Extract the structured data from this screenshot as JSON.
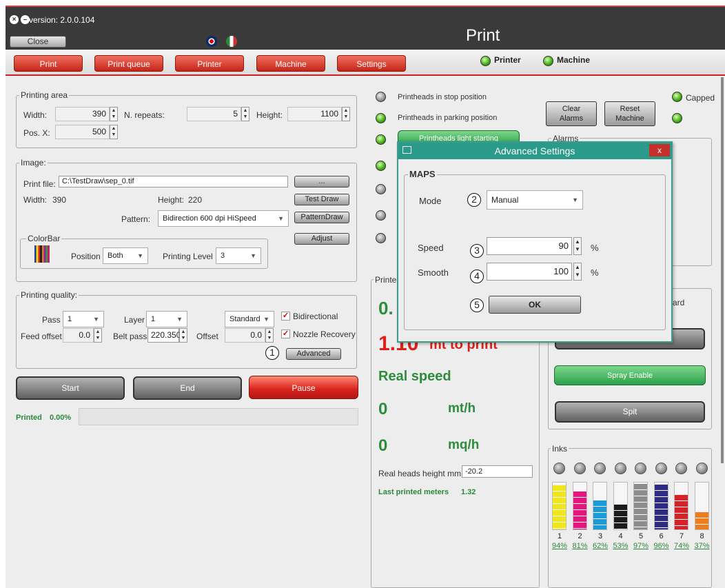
{
  "titlebar": {
    "version": "version: 2.0.0.104",
    "close": "Close",
    "title": "Print"
  },
  "nav": {
    "tabs": [
      "Print",
      "Print queue",
      "Printer",
      "Machine",
      "Settings"
    ],
    "printer": "Printer",
    "machine": "Machine"
  },
  "printing_area": {
    "label": "Printing area",
    "width_label": "Width:",
    "width": "390",
    "repeats_label": "N. repeats:",
    "repeats": "5",
    "height_label": "Height:",
    "height": "1100",
    "posx_label": "Pos. X:",
    "posx": "500"
  },
  "image": {
    "label": "Image:",
    "file_label": "Print file:",
    "file": "C:\\TestDraw\\sep_0.tif",
    "browse": "...",
    "width_label": "Width:",
    "width": "390",
    "height_label": "Height:",
    "height": "220",
    "test_draw": "Test Draw",
    "pattern_label": "Pattern:",
    "pattern": "Bidirection 600 dpi HiSpeed",
    "pattern_draw": "PatternDraw",
    "colorbar": "ColorBar",
    "position_label": "Position",
    "position": "Both",
    "adjust": "Adjust",
    "level_label": "Printing Level",
    "level": "3"
  },
  "quality": {
    "label": "Printing quality:",
    "pass_label": "Pass",
    "pass": "1",
    "layer_label": "Layer",
    "layer": "1",
    "mode": "Standard",
    "bidir": "Bidirectional",
    "feed_label": "Feed offset",
    "feed": "0.0",
    "belt_label": "Belt pass",
    "belt": "220.350",
    "offset_label": "Offset",
    "offset": "0.0",
    "nozzle": "Nozzle Recovery",
    "advanced": "Advanced"
  },
  "actions": {
    "start": "Start",
    "end": "End",
    "pause": "Pause",
    "printed_label": "Printed",
    "printed": "0.00%"
  },
  "status": {
    "stop": "Printheads in stop position",
    "parking": "Printheads in parking position",
    "light": "Printheads light starting",
    "clear": [
      "Clear",
      "Alarms"
    ],
    "reset": [
      "Reset",
      "Machine"
    ],
    "capped": "Capped",
    "alarms": "Alarms"
  },
  "print_panel": {
    "label": "Printe",
    "val1": "0.",
    "mt": "1.10",
    "mt_label": "mt to print",
    "real_speed": "Real speed",
    "mth_val": "0",
    "mth": "mt/h",
    "mqh_val": "0",
    "mqh": "mq/h",
    "heads_label": "Real heads height mm",
    "heads": "-20.2",
    "last_label": "Last printed meters",
    "last": "1.32"
  },
  "right_panel": {
    "ard": "ard",
    "spray": "Spray Enable",
    "spit": "Spit"
  },
  "inks": {
    "label": "Inks",
    "nums": [
      "1",
      "2",
      "3",
      "4",
      "5",
      "6",
      "7",
      "8"
    ],
    "pct": [
      "94%",
      "81%",
      "62%",
      "53%",
      "97%",
      "96%",
      "74%",
      "37%"
    ],
    "levels": [
      0.94,
      0.81,
      0.62,
      0.53,
      0.97,
      0.96,
      0.74,
      0.37
    ],
    "colors": [
      "#f1e61c",
      "#e5177f",
      "#1a9bd7",
      "#1b1b1b",
      "#8c8c8c",
      "#2e2a86",
      "#d6232a",
      "#ef7d1e"
    ]
  },
  "dialog": {
    "title": "Advanced Settings",
    "close": "x",
    "group": "MAPS",
    "mode_label": "Mode",
    "mode": "Manual",
    "speed_label": "Speed",
    "speed": "90",
    "smooth_label": "Smooth",
    "smooth": "100",
    "unit": "%",
    "ok": "OK"
  },
  "callouts": [
    "1",
    "2",
    "3",
    "4",
    "5"
  ]
}
